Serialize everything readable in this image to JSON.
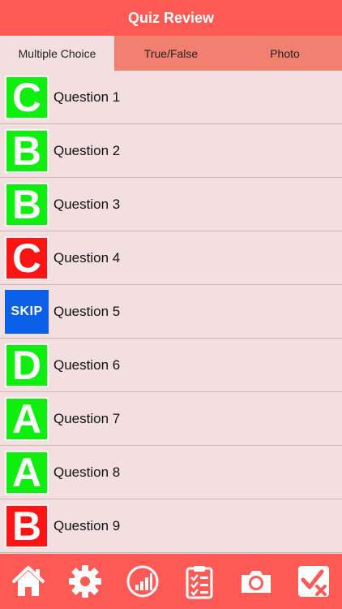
{
  "header": {
    "title": "Quiz Review"
  },
  "tabs": [
    {
      "label": "Multiple Choice"
    },
    {
      "label": "True/False"
    },
    {
      "label": "Photo"
    }
  ],
  "colors": {
    "correct": "#10ee10",
    "wrong": "#ff1414",
    "skip": "#0a5ee8",
    "accent": "#ff5a55"
  },
  "questions": [
    {
      "label": "Question 1",
      "badge": "C",
      "status": "correct"
    },
    {
      "label": "Question 2",
      "badge": "B",
      "status": "correct"
    },
    {
      "label": "Question 3",
      "badge": "B",
      "status": "correct"
    },
    {
      "label": "Question 4",
      "badge": "C",
      "status": "wrong"
    },
    {
      "label": "Question 5",
      "badge": "SKIP",
      "status": "skip"
    },
    {
      "label": "Question 6",
      "badge": "D",
      "status": "correct"
    },
    {
      "label": "Question 7",
      "badge": "A",
      "status": "correct"
    },
    {
      "label": "Question 8",
      "badge": "A",
      "status": "correct"
    },
    {
      "label": "Question 9",
      "badge": "B",
      "status": "wrong"
    }
  ],
  "toolbar": {
    "icons": [
      "home-icon",
      "gear-icon",
      "stats-icon",
      "clipboard-icon",
      "camera-icon",
      "checkbox-x-icon"
    ]
  }
}
